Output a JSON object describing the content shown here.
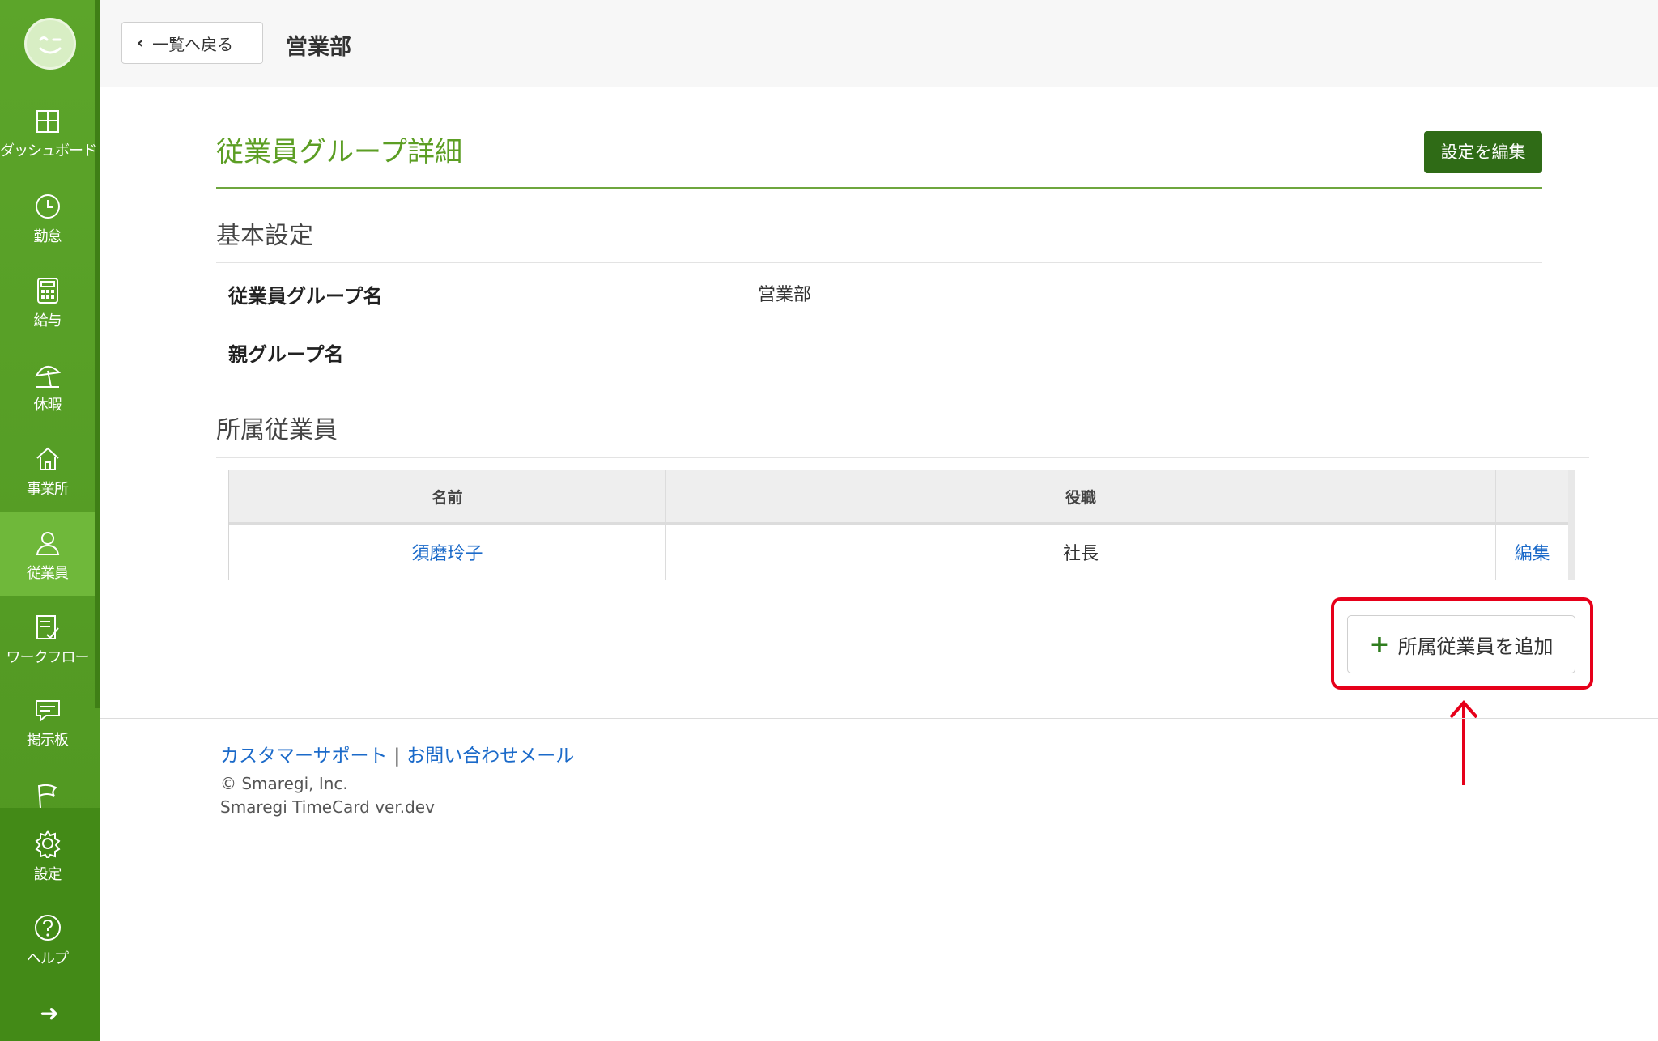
{
  "sidebar": {
    "items": [
      {
        "label": "ダッシュボード",
        "icon": "dashboard-icon"
      },
      {
        "label": "勤怠",
        "icon": "clock-icon"
      },
      {
        "label": "給与",
        "icon": "calculator-icon"
      },
      {
        "label": "休暇",
        "icon": "beach-umbrella-icon"
      },
      {
        "label": "事業所",
        "icon": "home-icon"
      },
      {
        "label": "従業員",
        "icon": "user-icon"
      },
      {
        "label": "ワークフロー",
        "icon": "checklist-icon"
      },
      {
        "label": "掲示板",
        "icon": "chat-icon"
      },
      {
        "label": "",
        "icon": "flag-icon"
      },
      {
        "label": "設定",
        "icon": "gear-icon"
      },
      {
        "label": "ヘルプ",
        "icon": "help-icon"
      }
    ],
    "collapse_icon": "arrow-right-icon"
  },
  "header": {
    "back_label": "一覧へ戻る",
    "title": "営業部"
  },
  "main": {
    "title": "従業員グループ詳細",
    "edit_settings_label": "設定を編集",
    "basic_section_title": "基本設定",
    "fields": [
      {
        "label": "従業員グループ名",
        "value": "営業部"
      },
      {
        "label": "親グループ名",
        "value": ""
      }
    ],
    "members_section_title": "所属従業員",
    "table": {
      "headers": [
        "名前",
        "役職",
        ""
      ],
      "rows": [
        {
          "name": "須磨玲子",
          "position": "社長",
          "action": "編集"
        }
      ]
    },
    "add_member_label": "所属従業員を追加"
  },
  "footer": {
    "support_link": "カスタマーサポート",
    "separator": "|",
    "contact_link": "お問い合わせメール",
    "copyright": "© Smaregi, Inc.",
    "version": "Smaregi TimeCard ver.dev"
  },
  "colors": {
    "brand_green": "#5ca52a",
    "title_green": "#5c9e24",
    "dark_button": "#2f6b16",
    "link_blue": "#1b6ac9",
    "highlight_red": "#e6001a"
  }
}
